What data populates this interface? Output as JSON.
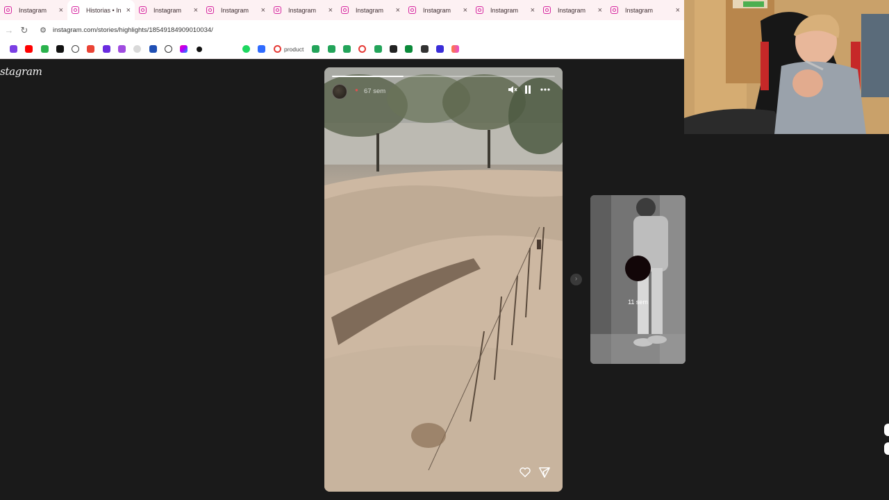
{
  "browser": {
    "tabs": [
      {
        "label": "Instagram",
        "active": false
      },
      {
        "label": "Historias • In",
        "active": true
      },
      {
        "label": "Instagram",
        "active": false
      },
      {
        "label": "Instagram",
        "active": false
      },
      {
        "label": "Instagram",
        "active": false
      },
      {
        "label": "Instagram",
        "active": false
      },
      {
        "label": "Instagram",
        "active": false
      },
      {
        "label": "Instagram",
        "active": false
      },
      {
        "label": "Instagram",
        "active": false
      },
      {
        "label": "Instagram",
        "active": false
      }
    ],
    "close_glyph": "×",
    "url": "instagram.com/stories/highlights/18549184909010034/",
    "bookmarks": {
      "product_label": "product",
      "icons": [
        "twitch-icon",
        "youtube-icon",
        "app-18-icon",
        "tiktok-icon",
        "openai-icon",
        "gmail-icon",
        "app-purple-icon",
        "app-pink-icon",
        "app-oo-icon",
        "paypal-icon",
        "whatsapp-icon",
        "app-triangle-icon",
        "app-dot-icon",
        "spotify-icon",
        "play-icon",
        "canva-icon",
        "sheets-icon-1",
        "sheets-icon-2",
        "sheets-icon-3",
        "canva-red-icon",
        "sheets-icon-4",
        "app-dark-icon",
        "app-green-icon",
        "app-dark2-icon",
        "app-blue-icon",
        "app-orange-icon"
      ]
    }
  },
  "instagram": {
    "logo": "stagram",
    "story": {
      "time": "67 sem",
      "progress": 0.32,
      "controls": {
        "mute_icon": "muted-speaker-icon",
        "pause_icon": "pause-icon",
        "more_icon": "more-icon"
      },
      "actions": {
        "like_icon": "heart-icon",
        "share_icon": "send-icon"
      }
    },
    "next_arrow": "›",
    "next_preview": {
      "time": "11 sem"
    }
  },
  "colors": {
    "page_bg": "#1a1a1a",
    "tabstrip_bg": "#fdf1f3",
    "instagram_accent": "#d6249f"
  }
}
